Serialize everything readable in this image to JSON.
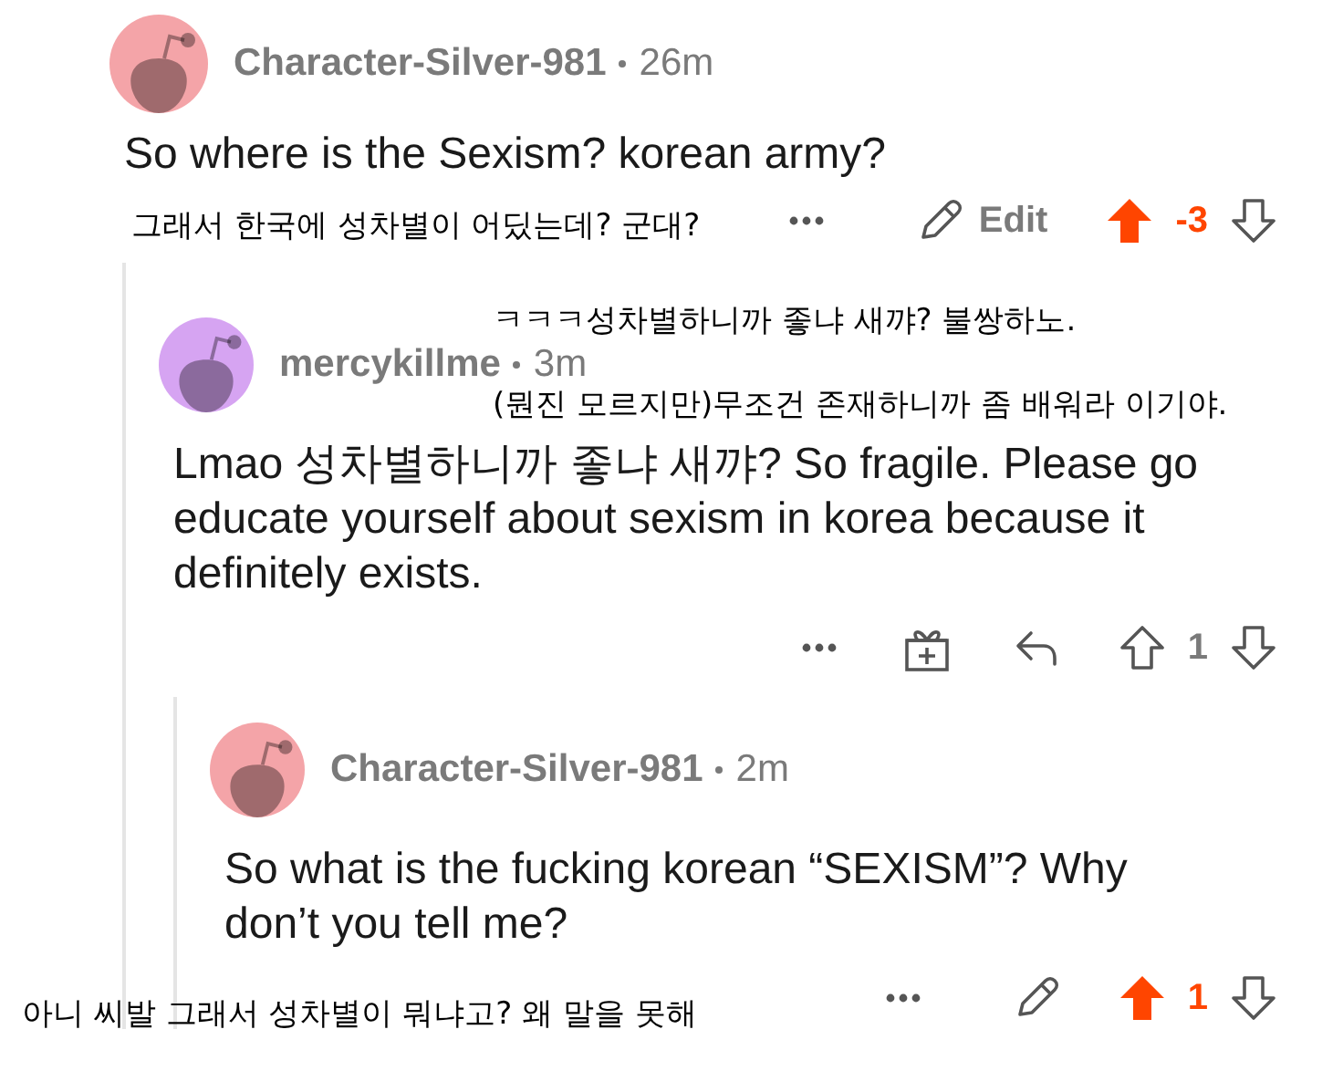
{
  "comments": [
    {
      "author": "Character-Silver-981",
      "time": "26m",
      "color": "#f4a4a8",
      "body": "So where is the Sexism? korean army?",
      "annotations": [
        "그래서 한국에 성차별이 어딨는데? 군대?"
      ],
      "actions": [
        {
          "kind": "more"
        },
        {
          "kind": "edit",
          "label": "Edit"
        }
      ],
      "upvoted": true,
      "score": "-3",
      "children": [
        {
          "author": "mercykillme",
          "time": "3m",
          "color": "#d6a4f2",
          "body": "Lmao 성차별하니까 좋냐 새꺄? So fragile. Please go educate yourself about sexism in korea because it definitely exists.",
          "annotations": [
            "ㅋㅋㅋ성차별하니까 좋냐 새꺄? 불쌍하노.",
            "(뭔진 모르지만)무조건 존재하니까 좀 배워라 이기야."
          ],
          "actions": [
            {
              "kind": "more"
            },
            {
              "kind": "gift"
            },
            {
              "kind": "reply"
            }
          ],
          "upvoted": false,
          "score": "1",
          "children": [
            {
              "author": "Character-Silver-981",
              "time": "2m",
              "color": "#f4a4a8",
              "body": "So what is the fucking korean “SEXISM”? Why don’t you tell me?",
              "annotations": [
                "아니 씨발 그래서 성차별이 뭐냐고? 왜 말을 못해"
              ],
              "actions": [
                {
                  "kind": "more"
                },
                {
                  "kind": "edit"
                }
              ],
              "upvoted": true,
              "score": "1"
            }
          ]
        }
      ]
    }
  ]
}
